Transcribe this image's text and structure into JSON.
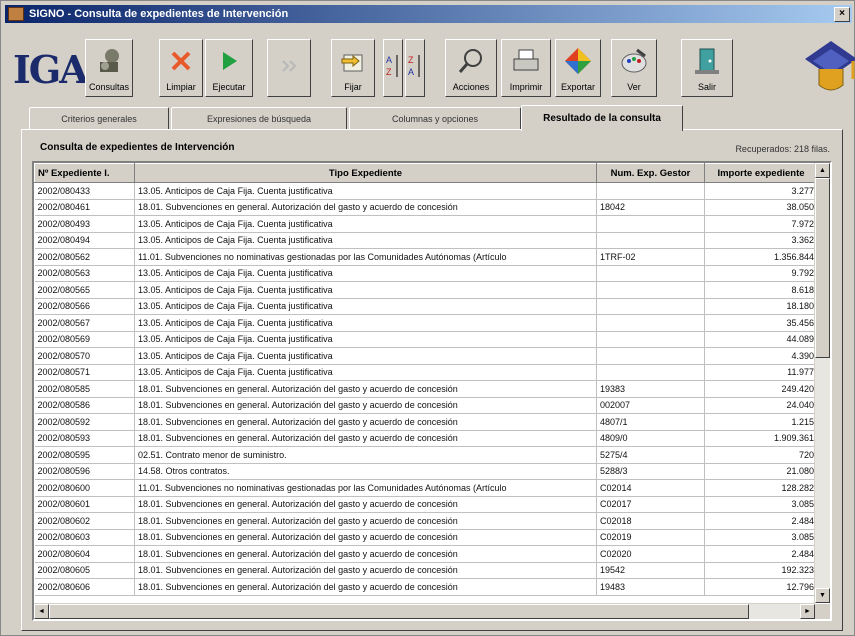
{
  "window": {
    "title": "SIGNO - Consulta de expedientes de Intervención"
  },
  "logo": "IGAE",
  "toolbar": [
    {
      "name": "consultas-button",
      "icon": "consultas-icon",
      "label": "Consultas",
      "enabled": true
    },
    {
      "name": "limpiar-button",
      "icon": "clear-x-icon",
      "label": "Limpiar",
      "enabled": true
    },
    {
      "name": "ejecutar-button",
      "icon": "play-icon",
      "label": "Ejecutar",
      "enabled": true
    },
    {
      "name": "parar-button",
      "icon": "pause-icon",
      "label": "",
      "enabled": false
    },
    {
      "name": "fijar-button",
      "icon": "pin-icon",
      "label": "Fijar",
      "enabled": true
    },
    {
      "name": "sort-asc-button",
      "icon": "sort-az-icon",
      "label": "",
      "enabled": true
    },
    {
      "name": "sort-desc-button",
      "icon": "sort-za-icon",
      "label": "",
      "enabled": true
    },
    {
      "name": "acciones-button",
      "icon": "magnifier-icon",
      "label": "Acciones",
      "enabled": true
    },
    {
      "name": "imprimir-button",
      "icon": "printer-icon",
      "label": "Imprimir",
      "enabled": true
    },
    {
      "name": "exportar-button",
      "icon": "export-icon",
      "label": "Exportar",
      "enabled": true
    },
    {
      "name": "ver-button",
      "icon": "palette-icon",
      "label": "Ver",
      "enabled": true
    },
    {
      "name": "salir-button",
      "icon": "exit-door-icon",
      "label": "Salir",
      "enabled": true
    }
  ],
  "tabs": [
    {
      "label": "Criterios generales",
      "active": false
    },
    {
      "label": "Expresiones de búsqueda",
      "active": false
    },
    {
      "label": "Columnas y opciones",
      "active": false
    },
    {
      "label": "Resultado de la consulta",
      "active": true
    }
  ],
  "panel": {
    "title": "Consulta de expedientes de Intervención",
    "recuperados": "Recuperados: 218 filas."
  },
  "table": {
    "columns": [
      "Nº Expediente I.",
      "Tipo Expediente",
      "Num. Exp. Gestor",
      "Importe expediente"
    ],
    "rows": [
      [
        "2002/080433",
        "13.05. Anticipos de Caja Fija. Cuenta justificativa",
        "",
        "3.277"
      ],
      [
        "2002/080461",
        "18.01. Subvenciones en general. Autorización del gasto y acuerdo de concesión",
        "18042",
        "38.050"
      ],
      [
        "2002/080493",
        "13.05. Anticipos de Caja Fija. Cuenta justificativa",
        "",
        "7.972"
      ],
      [
        "2002/080494",
        "13.05. Anticipos de Caja Fija. Cuenta justificativa",
        "",
        "3.362"
      ],
      [
        "2002/080562",
        "11.01. Subvenciones no nominativas gestionadas por las Comunidades Autónomas (Artículo",
        "1TRF-02",
        "1.356.844"
      ],
      [
        "2002/080563",
        "13.05. Anticipos de Caja Fija. Cuenta justificativa",
        "",
        "9.792"
      ],
      [
        "2002/080565",
        "13.05. Anticipos de Caja Fija. Cuenta justificativa",
        "",
        "8.618"
      ],
      [
        "2002/080566",
        "13.05. Anticipos de Caja Fija. Cuenta justificativa",
        "",
        "18.180"
      ],
      [
        "2002/080567",
        "13.05. Anticipos de Caja Fija. Cuenta justificativa",
        "",
        "35.456"
      ],
      [
        "2002/080569",
        "13.05. Anticipos de Caja Fija. Cuenta justificativa",
        "",
        "44.089"
      ],
      [
        "2002/080570",
        "13.05. Anticipos de Caja Fija. Cuenta justificativa",
        "",
        "4.390"
      ],
      [
        "2002/080571",
        "13.05. Anticipos de Caja Fija. Cuenta justificativa",
        "",
        "11.977"
      ],
      [
        "2002/080585",
        "18.01. Subvenciones en general. Autorización del gasto y acuerdo de concesión",
        "19383",
        "249.420"
      ],
      [
        "2002/080586",
        "18.01. Subvenciones en general. Autorización del gasto y acuerdo de concesión",
        "002007",
        "24.040"
      ],
      [
        "2002/080592",
        "18.01. Subvenciones en general. Autorización del gasto y acuerdo de concesión",
        "4807/1",
        "1.215"
      ],
      [
        "2002/080593",
        "18.01. Subvenciones en general. Autorización del gasto y acuerdo de concesión",
        "4809/0",
        "1.909.361"
      ],
      [
        "2002/080595",
        "02.51. Contrato menor de suministro.",
        "5275/4",
        "720"
      ],
      [
        "2002/080596",
        "14.58. Otros contratos.",
        "5288/3",
        "21.080"
      ],
      [
        "2002/080600",
        "11.01. Subvenciones no nominativas gestionadas por las Comunidades Autónomas (Artículo",
        "C02014",
        "128.282"
      ],
      [
        "2002/080601",
        "18.01. Subvenciones en general. Autorización del gasto y acuerdo de concesión",
        "C02017",
        "3.085"
      ],
      [
        "2002/080602",
        "18.01. Subvenciones en general. Autorización del gasto y acuerdo de concesión",
        "C02018",
        "2.484"
      ],
      [
        "2002/080603",
        "18.01. Subvenciones en general. Autorización del gasto y acuerdo de concesión",
        "C02019",
        "3.085"
      ],
      [
        "2002/080604",
        "18.01. Subvenciones en general. Autorización del gasto y acuerdo de concesión",
        "C02020",
        "2.484"
      ],
      [
        "2002/080605",
        "18.01. Subvenciones en general. Autorización del gasto y acuerdo de concesión",
        "19542",
        "192.323"
      ],
      [
        "2002/080606",
        "18.01. Subvenciones en general. Autorización del gasto y acuerdo de concesión",
        "19483",
        "12.796"
      ]
    ]
  },
  "colors": {
    "titlebar_start": "#0a246a",
    "titlebar_end": "#a6caf0",
    "face": "#d4d0c8"
  }
}
